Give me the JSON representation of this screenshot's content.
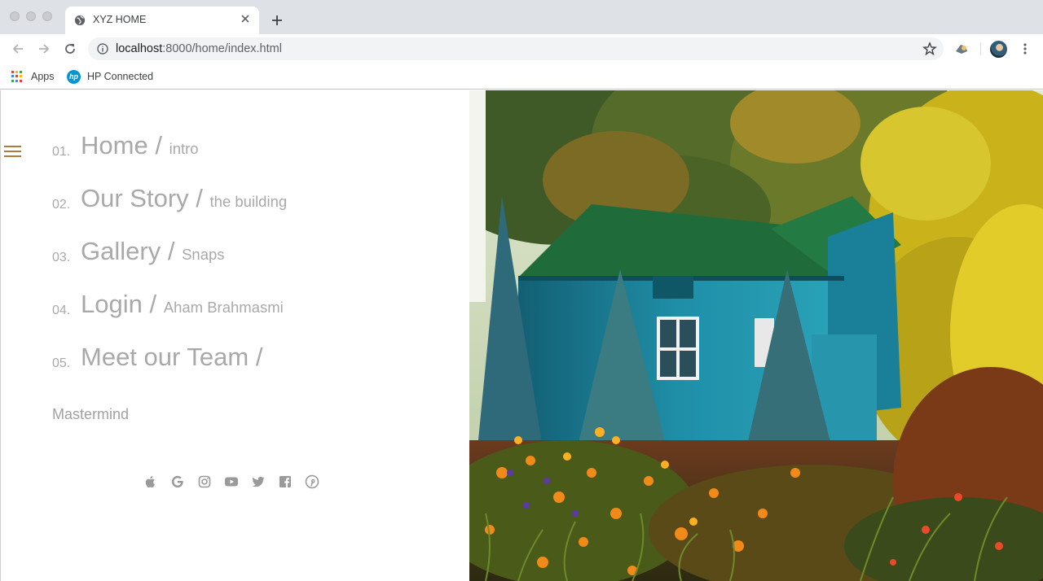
{
  "browser": {
    "tab": {
      "title": "XYZ HOME"
    },
    "address": {
      "host": "localhost",
      "rest": ":8000/home/index.html"
    },
    "bookmarks": [
      {
        "label": "Apps",
        "icon": "apps-grid-icon"
      },
      {
        "label": "HP Connected",
        "icon": "hp-logo-icon"
      }
    ]
  },
  "nav": {
    "items": [
      {
        "num": "01.",
        "title": "Home",
        "sub": "intro"
      },
      {
        "num": "02.",
        "title": "Our Story",
        "sub": "the building"
      },
      {
        "num": "03.",
        "title": "Gallery",
        "sub": "Snaps"
      },
      {
        "num": "04.",
        "title": "Login",
        "sub": "Aham Brahmasmi"
      },
      {
        "num": "05.",
        "title": "Meet our Team",
        "sub": ""
      }
    ],
    "separator": "/",
    "footer_text": "Mastermind"
  },
  "social": [
    "apple-icon",
    "google-icon",
    "instagram-icon",
    "youtube-icon",
    "twitter-icon",
    "facebook-icon",
    "pinterest-icon"
  ],
  "colors": {
    "menu_text": "#a9a9a9",
    "hamburger": "#b07a3a",
    "house": "#1f8fa8",
    "roof": "#1f6b3a"
  }
}
